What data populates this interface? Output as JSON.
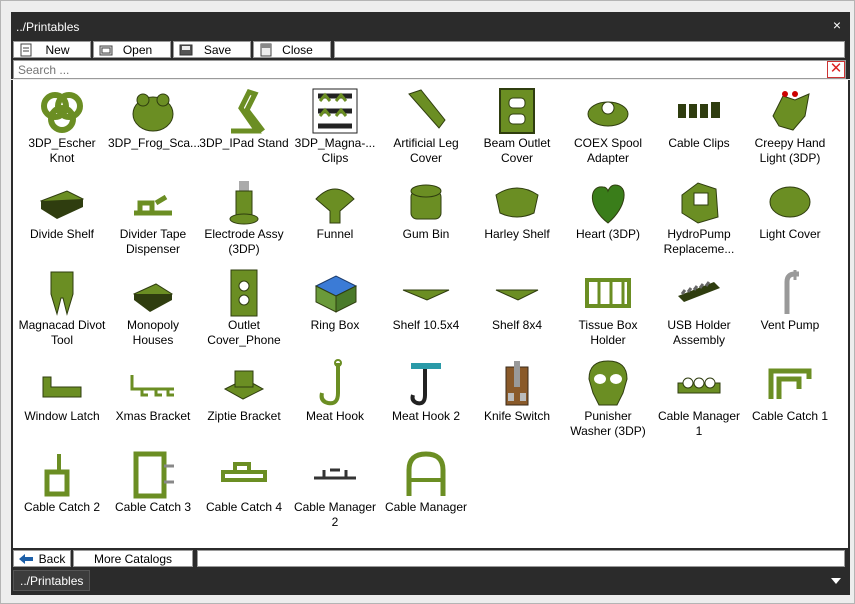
{
  "window": {
    "title": "../Printables",
    "close_label": "×"
  },
  "toolbar": {
    "new_label": "New",
    "open_label": "Open",
    "save_label": "Save",
    "close_label": "Close"
  },
  "search": {
    "placeholder": "Search ...",
    "value": "",
    "clear_label": "✕"
  },
  "items": [
    {
      "label": "3DP_Escher\nKnot",
      "icon": "escher-knot-icon"
    },
    {
      "label": "3DP_Frog_Sca...",
      "icon": "frog-icon"
    },
    {
      "label": "3DP_IPad Stand",
      "icon": "ipad-stand-icon"
    },
    {
      "label": "3DP_Magna-...\nClips",
      "icon": "magna-clips-icon"
    },
    {
      "label": "Artificial Leg\nCover",
      "icon": "leg-cover-icon"
    },
    {
      "label": "Beam Outlet\nCover",
      "icon": "outlet-cover-icon"
    },
    {
      "label": "COEX Spool\nAdapter",
      "icon": "spool-adapter-icon"
    },
    {
      "label": "Cable Clips",
      "icon": "cable-clips-icon"
    },
    {
      "label": "Creepy Hand\nLight (3DP)",
      "icon": "creepy-hand-icon"
    },
    {
      "label": "Divide Shelf",
      "icon": "divide-shelf-icon"
    },
    {
      "label": "Divider Tape\nDispenser",
      "icon": "tape-dispenser-icon"
    },
    {
      "label": "Electrode Assy\n(3DP)",
      "icon": "electrode-icon"
    },
    {
      "label": "Funnel",
      "icon": "funnel-icon"
    },
    {
      "label": "Gum Bin",
      "icon": "gum-bin-icon"
    },
    {
      "label": "Harley Shelf",
      "icon": "harley-shelf-icon"
    },
    {
      "label": "Heart (3DP)",
      "icon": "heart-icon"
    },
    {
      "label": "HydroPump\nReplaceme...",
      "icon": "hydropump-icon"
    },
    {
      "label": "Light Cover",
      "icon": "light-cover-icon"
    },
    {
      "label": "Magnacad Divot\nTool",
      "icon": "divot-tool-icon"
    },
    {
      "label": "Monopoly\nHouses",
      "icon": "monopoly-houses-icon"
    },
    {
      "label": "Outlet\nCover_Phone",
      "icon": "outlet-phone-icon"
    },
    {
      "label": "Ring Box",
      "icon": "ring-box-icon"
    },
    {
      "label": "Shelf 10.5x4",
      "icon": "shelf-10-icon"
    },
    {
      "label": "Shelf 8x4",
      "icon": "shelf-8-icon"
    },
    {
      "label": "Tissue Box\nHolder",
      "icon": "tissue-box-icon"
    },
    {
      "label": "USB Holder\nAssembly",
      "icon": "usb-holder-icon"
    },
    {
      "label": "Vent Pump",
      "icon": "vent-pump-icon"
    },
    {
      "label": "Window Latch",
      "icon": "window-latch-icon"
    },
    {
      "label": "Xmas Bracket",
      "icon": "xmas-bracket-icon"
    },
    {
      "label": "Ziptie Bracket",
      "icon": "ziptie-bracket-icon"
    },
    {
      "label": "Meat Hook",
      "icon": "meat-hook-icon"
    },
    {
      "label": "Meat Hook 2",
      "icon": "meat-hook2-icon"
    },
    {
      "label": "Knife Switch",
      "icon": "knife-switch-icon"
    },
    {
      "label": "Punisher\nWasher (3DP)",
      "icon": "punisher-icon"
    },
    {
      "label": "Cable Manager\n1",
      "icon": "cable-manager1-icon"
    },
    {
      "label": "Cable Catch 1",
      "icon": "cable-catch1-icon"
    },
    {
      "label": "Cable Catch 2",
      "icon": "cable-catch2-icon"
    },
    {
      "label": "Cable Catch 3",
      "icon": "cable-catch3-icon"
    },
    {
      "label": "Cable Catch 4",
      "icon": "cable-catch4-icon"
    },
    {
      "label": "Cable Manager\n2",
      "icon": "cable-manager2-icon"
    },
    {
      "label": "Cable Manager",
      "icon": "cable-manager-icon"
    }
  ],
  "bottom": {
    "back_label": "Back",
    "more_label": "More Catalogs"
  },
  "status": {
    "breadcrumb": "../Printables"
  },
  "colors": {
    "model_green": "#6b8e23",
    "model_dark": "#2f3d0f",
    "chrome": "#2b2b2b"
  }
}
